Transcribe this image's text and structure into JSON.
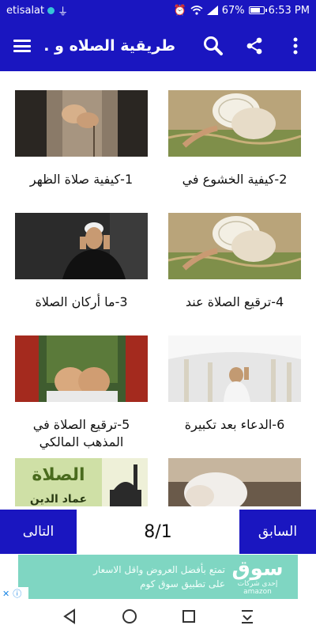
{
  "status_bar": {
    "carrier": "etisalat",
    "battery": "67%",
    "time": "6:53 PM",
    "battery_level": 0.67
  },
  "toolbar": {
    "title": "طريقية الصلاه و ...",
    "icons": [
      "menu-icon",
      "search-icon",
      "share-icon",
      "more-vert-icon"
    ]
  },
  "items": [
    {
      "title": "1-كيفية صلاة الظهر",
      "image": "hands-prayer-photo"
    },
    {
      "title": "2-كيفية الخشوع في",
      "image": "prostration-photo"
    },
    {
      "title": "3-ما أركان الصلاة",
      "image": "man-praying-takbir-photo"
    },
    {
      "title": "4-ترقيع الصلاة عند",
      "image": "prostration-photo"
    },
    {
      "title": "5-ترقيع الصلاة في المذهب المالكي",
      "image": "hands-dua-photo"
    },
    {
      "title": "6-الدعاء بعد تكبيرة",
      "image": "mosque-dua-photo"
    },
    {
      "title": "",
      "image": "book-cover-photo"
    },
    {
      "title": "",
      "image": "sujood-photo"
    }
  ],
  "book_cover": {
    "line1": "الصلاة",
    "line2": "عماد الدين"
  },
  "pager": {
    "next_label": "التالى",
    "count": "8/1",
    "prev_label": "السابق"
  },
  "ad": {
    "line1": "تمتع بأفضل العروض واقل الاسعار",
    "line2": "على تطبيق سوق كوم",
    "brand": "سوق",
    "brand_sub": "إحدى شركات amazon"
  },
  "colors": {
    "primary": "#1a16c0",
    "ad_bg": "#7fd6c2"
  }
}
